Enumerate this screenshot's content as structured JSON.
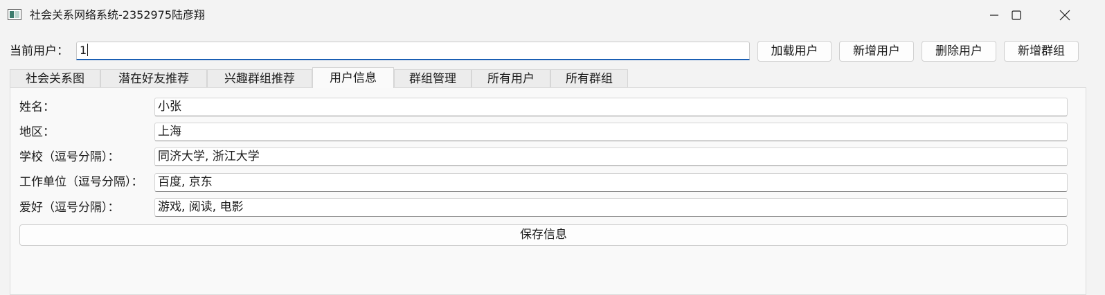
{
  "window": {
    "title": "社会关系网络系统-2352975陆彦翔",
    "icon": "app-window-icon"
  },
  "toolbar": {
    "current_user_label": "当前用户：",
    "current_user_value": "1",
    "load_user": "加载用户",
    "add_user": "新增用户",
    "delete_user": "删除用户",
    "add_group": "新增群组"
  },
  "tabs": [
    {
      "label": "社会关系图",
      "active": false
    },
    {
      "label": "潜在好友推荐",
      "active": false
    },
    {
      "label": "兴趣群组推荐",
      "active": false
    },
    {
      "label": "用户信息",
      "active": true
    },
    {
      "label": "群组管理",
      "active": false
    },
    {
      "label": "所有用户",
      "active": false
    },
    {
      "label": "所有群组",
      "active": false
    }
  ],
  "user_info": {
    "name_label": "姓名：",
    "name_value": "小张",
    "region_label": "地区：",
    "region_value": "上海",
    "school_label": "学校（逗号分隔）：",
    "school_value": "同济大学, 浙江大学",
    "work_label": "工作单位（逗号分隔）：",
    "work_value": "百度, 京东",
    "hobby_label": "爱好（逗号分隔）：",
    "hobby_value": "游戏, 阅读, 电影",
    "save_label": "保存信息"
  }
}
